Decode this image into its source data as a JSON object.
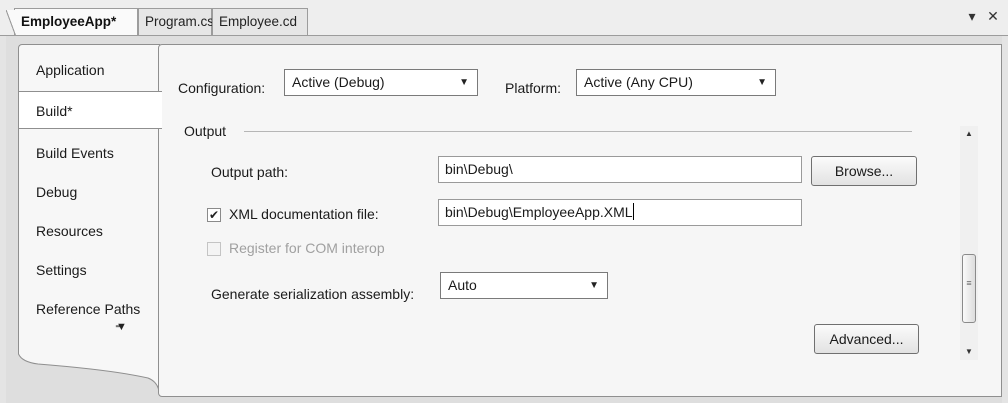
{
  "tabs": [
    {
      "label": "EmployeeApp*",
      "active": true
    },
    {
      "label": "Program.cs",
      "active": false
    },
    {
      "label": "Employee.cd",
      "active": false
    }
  ],
  "window_icons": {
    "dropdown": "dropdown-arrow-icon",
    "close": "close-icon"
  },
  "sidebar": {
    "items": [
      {
        "label": "Application"
      },
      {
        "label": "Build*",
        "active": true
      },
      {
        "label": "Build Events"
      },
      {
        "label": "Debug"
      },
      {
        "label": "Resources"
      },
      {
        "label": "Settings"
      },
      {
        "label": "Reference Paths"
      }
    ],
    "overflow_icon": "overflow-chevron-icon"
  },
  "config": {
    "configuration_label": "Configuration:",
    "configuration_value": "Active (Debug)",
    "platform_label": "Platform:",
    "platform_value": "Active (Any CPU)"
  },
  "output": {
    "section_title": "Output",
    "output_path_label": "Output path:",
    "output_path_value": "bin\\Debug\\",
    "browse_label": "Browse...",
    "xml_doc_label": "XML documentation file:",
    "xml_doc_checked": true,
    "xml_doc_value": "bin\\Debug\\EmployeeApp.XML",
    "com_interop_label": "Register for COM interop",
    "com_interop_checked": false,
    "com_interop_enabled": false,
    "serialization_label": "Generate serialization assembly:",
    "serialization_value": "Auto",
    "advanced_label": "Advanced..."
  },
  "colors": {
    "background": "#e4e4e4",
    "content_bg": "#f6f6f6",
    "border": "#8f8f8f",
    "disabled_text": "#a0a0a0"
  }
}
